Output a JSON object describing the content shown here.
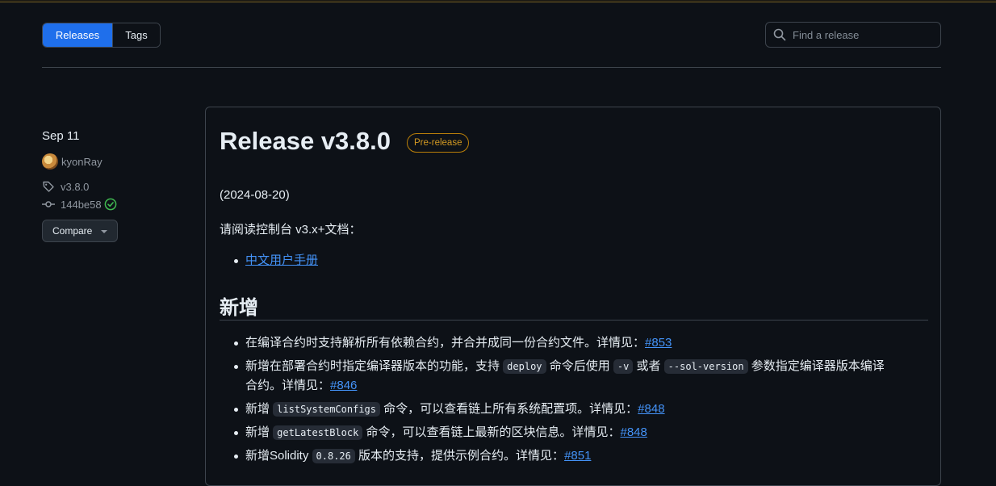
{
  "tabs": {
    "releases": "Releases",
    "tags": "Tags"
  },
  "search": {
    "placeholder": "Find a release"
  },
  "sidebar": {
    "date": "Sep 11",
    "author": "kyonRay",
    "tag": "v3.8.0",
    "commit": "144be58",
    "compare": "Compare"
  },
  "release": {
    "title": "Release v3.8.0",
    "badge": "Pre-release",
    "date_line": "(2024-08-20)",
    "docs_intro": "请阅读控制台 v3.x+文档：",
    "docs_link": "中文用户手册",
    "section_new": "新增",
    "items": [
      {
        "pre": "在编译合约时支持解析所有依赖合约，并合并成同一份合约文件。详情见：",
        "link": "#853"
      },
      {
        "a": "新增在部署合约时指定编译器版本的功能，支持 ",
        "c1": "deploy",
        "b": " 命令后使用 ",
        "c2": "-v",
        "c": " 或者 ",
        "c3": "--sol-version",
        "d": " 参数指定编译器版本编译",
        "e": "合约。详情见：",
        "link": "#846"
      },
      {
        "pre": "新增 ",
        "code": "listSystemConfigs",
        "post": " 命令，可以查看链上所有系统配置项。详情见：",
        "link": "#848"
      },
      {
        "pre": "新增 ",
        "code": "getLatestBlock",
        "post": " 命令，可以查看链上最新的区块信息。详情见：",
        "link": "#848"
      },
      {
        "pre": "新增Solidity ",
        "code": "0.8.26",
        "post": " 版本的支持，提供示例合约。详情见：",
        "link": "#851"
      }
    ]
  },
  "colors": {
    "accent": "#1f6feb",
    "link": "#4493f8",
    "prerelease": "#d29922",
    "success": "#3fb950"
  }
}
